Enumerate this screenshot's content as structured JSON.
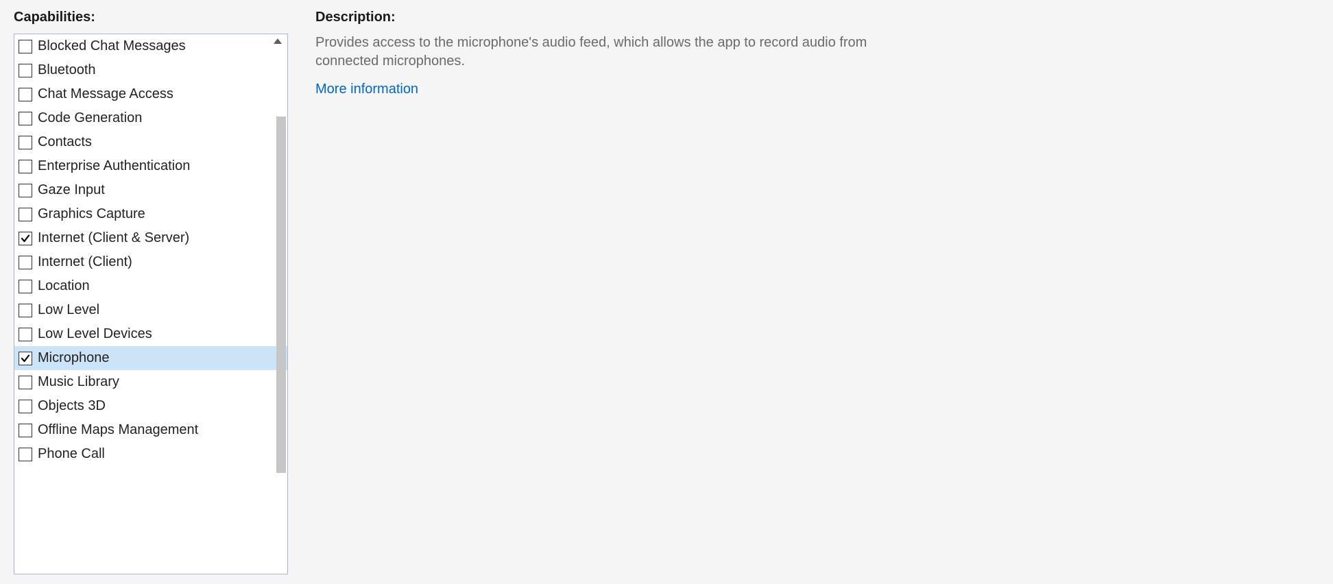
{
  "left": {
    "heading": "Capabilities:"
  },
  "right": {
    "heading": "Description:",
    "description": "Provides access to the microphone's audio feed, which allows the app to record audio from connected microphones.",
    "more_link": "More information"
  },
  "capabilities": [
    {
      "label": "Blocked Chat Messages",
      "checked": false,
      "selected": false
    },
    {
      "label": "Bluetooth",
      "checked": false,
      "selected": false
    },
    {
      "label": "Chat Message Access",
      "checked": false,
      "selected": false
    },
    {
      "label": "Code Generation",
      "checked": false,
      "selected": false
    },
    {
      "label": "Contacts",
      "checked": false,
      "selected": false
    },
    {
      "label": "Enterprise Authentication",
      "checked": false,
      "selected": false
    },
    {
      "label": "Gaze Input",
      "checked": false,
      "selected": false
    },
    {
      "label": "Graphics Capture",
      "checked": false,
      "selected": false
    },
    {
      "label": "Internet (Client & Server)",
      "checked": true,
      "selected": false
    },
    {
      "label": "Internet (Client)",
      "checked": false,
      "selected": false
    },
    {
      "label": "Location",
      "checked": false,
      "selected": false
    },
    {
      "label": "Low Level",
      "checked": false,
      "selected": false
    },
    {
      "label": "Low Level Devices",
      "checked": false,
      "selected": false
    },
    {
      "label": "Microphone",
      "checked": true,
      "selected": true
    },
    {
      "label": "Music Library",
      "checked": false,
      "selected": false
    },
    {
      "label": "Objects 3D",
      "checked": false,
      "selected": false
    },
    {
      "label": "Offline Maps Management",
      "checked": false,
      "selected": false
    },
    {
      "label": "Phone Call",
      "checked": false,
      "selected": false
    }
  ]
}
